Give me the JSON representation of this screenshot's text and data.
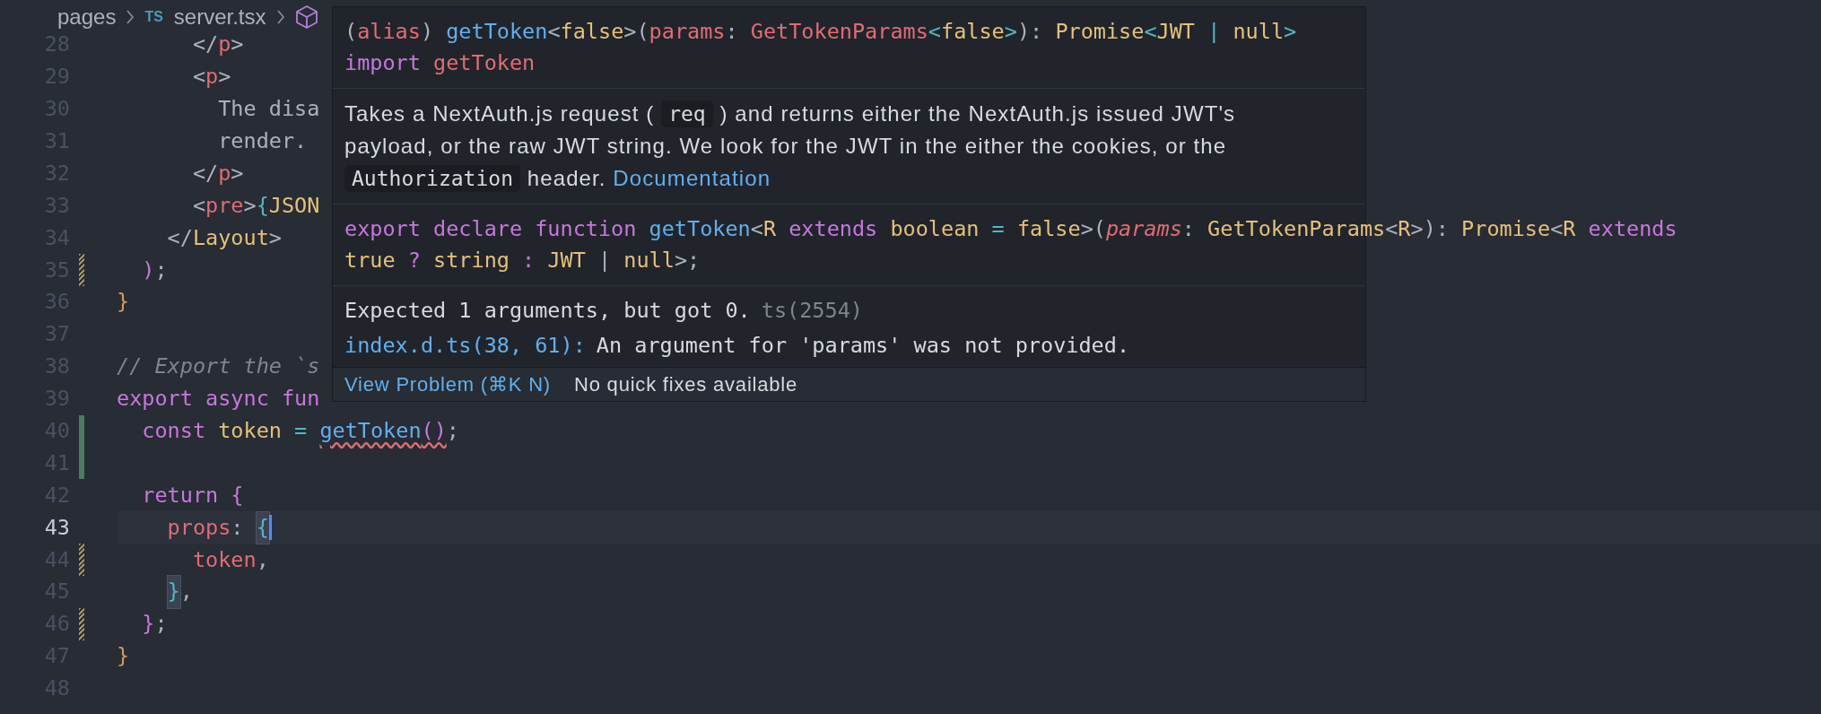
{
  "breadcrumb": [
    {
      "kind": "folder",
      "label": "pages"
    },
    {
      "kind": "file",
      "badge": "TS",
      "label": "server.tsx"
    },
    {
      "kind": "symbol"
    }
  ],
  "lines": [
    {
      "number": "28",
      "added": false,
      "modified": false,
      "current": false,
      "tokens": [
        {
          "text": "      </",
          "kind": "plain"
        },
        {
          "text": "p",
          "kind": "tag"
        },
        {
          "text": ">",
          "kind": "plain"
        }
      ]
    },
    {
      "number": "29",
      "added": false,
      "modified": false,
      "current": false,
      "tokens": [
        {
          "text": "      <",
          "kind": "plain"
        },
        {
          "text": "p",
          "kind": "tag"
        },
        {
          "text": ">",
          "kind": "plain"
        }
      ]
    },
    {
      "number": "30",
      "added": false,
      "modified": false,
      "current": false,
      "tokens": [
        {
          "text": "        The disa",
          "kind": "plain"
        }
      ]
    },
    {
      "number": "31",
      "added": false,
      "modified": false,
      "current": false,
      "tokens": [
        {
          "text": "        render.",
          "kind": "plain"
        }
      ]
    },
    {
      "number": "32",
      "added": false,
      "modified": false,
      "current": false,
      "tokens": [
        {
          "text": "      </",
          "kind": "plain"
        },
        {
          "text": "p",
          "kind": "tag"
        },
        {
          "text": ">",
          "kind": "plain"
        }
      ]
    },
    {
      "number": "33",
      "added": false,
      "modified": false,
      "current": false,
      "tokens": [
        {
          "text": "      <",
          "kind": "plain"
        },
        {
          "text": "pre",
          "kind": "tag"
        },
        {
          "text": ">",
          "kind": "plain"
        },
        {
          "text": "{",
          "kind": "punct"
        },
        {
          "text": "JSON",
          "kind": "type"
        }
      ]
    },
    {
      "number": "34",
      "added": false,
      "modified": false,
      "current": false,
      "tokens": [
        {
          "text": "    </",
          "kind": "plain"
        },
        {
          "text": "Layout",
          "kind": "type"
        },
        {
          "text": ">",
          "kind": "plain"
        }
      ]
    },
    {
      "number": "35",
      "added": false,
      "modified": true,
      "current": false,
      "tokens": [
        {
          "text": "  )",
          "kind": "keyword"
        },
        {
          "text": ";",
          "kind": "plain"
        }
      ]
    },
    {
      "number": "36",
      "added": false,
      "modified": false,
      "current": false,
      "tokens": [
        {
          "text": "}",
          "kind": "orange"
        }
      ]
    },
    {
      "number": "37",
      "added": false,
      "modified": false,
      "current": false
    },
    {
      "number": "38",
      "added": false,
      "modified": false,
      "current": false,
      "tokens": [
        {
          "text": "// Export the `s",
          "kind": "comment"
        }
      ]
    },
    {
      "number": "39",
      "added": false,
      "modified": false,
      "current": false,
      "tokens": [
        {
          "text": "export async fun",
          "kind": "keyword"
        }
      ]
    },
    {
      "number": "40",
      "added": true,
      "modified": false,
      "current": false,
      "tokens": [
        {
          "text": "  const ",
          "kind": "keyword"
        },
        {
          "text": "token ",
          "kind": "type"
        },
        {
          "text": "= ",
          "kind": "punct"
        },
        {
          "text": "getToken",
          "kind": "func",
          "squiggle": true
        },
        {
          "text": "()",
          "kind": "keyword",
          "squiggle": true
        },
        {
          "text": ";",
          "kind": "plain"
        }
      ]
    },
    {
      "number": "41",
      "added": true,
      "modified": false,
      "current": false
    },
    {
      "number": "42",
      "added": false,
      "modified": false,
      "current": false,
      "tokens": [
        {
          "text": "  return ",
          "kind": "keyword"
        },
        {
          "text": "{",
          "kind": "keyword"
        }
      ]
    },
    {
      "number": "43",
      "added": false,
      "modified": false,
      "current": true,
      "tokens": [
        {
          "text": "    props",
          "kind": "tag"
        },
        {
          "text": ": ",
          "kind": "plain"
        },
        {
          "text": "{",
          "kind": "punct",
          "match": true
        }
      ]
    },
    {
      "number": "44",
      "added": false,
      "modified": true,
      "current": false,
      "tokens": [
        {
          "text": "      token",
          "kind": "tag"
        },
        {
          "text": ",",
          "kind": "plain"
        }
      ]
    },
    {
      "number": "45",
      "added": false,
      "modified": false,
      "current": false,
      "tokens": [
        {
          "text": "    }",
          "kind": "punct",
          "match": true
        },
        {
          "text": ",",
          "kind": "plain"
        }
      ]
    },
    {
      "number": "46",
      "added": false,
      "modified": true,
      "current": false,
      "tokens": [
        {
          "text": "  }",
          "kind": "keyword"
        },
        {
          "text": ";",
          "kind": "plain"
        }
      ]
    },
    {
      "number": "47",
      "added": false,
      "modified": false,
      "current": false,
      "tokens": [
        {
          "text": "}",
          "kind": "orange"
        }
      ]
    },
    {
      "number": "48",
      "added": false,
      "modified": false,
      "current": false
    }
  ],
  "hover": {
    "signature": [
      [
        {
          "text": "(",
          "kind": "plain"
        },
        {
          "text": "alias",
          "kind": "tag"
        },
        {
          "text": ") ",
          "kind": "plain"
        },
        {
          "text": "getToken",
          "kind": "func"
        },
        {
          "text": "<",
          "kind": "plain"
        },
        {
          "text": "false",
          "kind": "type"
        },
        {
          "text": ">(",
          "kind": "plain"
        },
        {
          "text": "params",
          "kind": "tag"
        },
        {
          "text": ": ",
          "kind": "plain"
        },
        {
          "text": "GetTokenParams",
          "kind": "tag"
        },
        {
          "text": "<",
          "kind": "punct"
        },
        {
          "text": "false",
          "kind": "type"
        },
        {
          "text": ">",
          "kind": "punct"
        },
        {
          "text": "): ",
          "kind": "plain"
        },
        {
          "text": "Promise",
          "kind": "type"
        },
        {
          "text": "<",
          "kind": "punct"
        },
        {
          "text": "JWT ",
          "kind": "type"
        },
        {
          "text": "| ",
          "kind": "punct"
        },
        {
          "text": "null",
          "kind": "type"
        },
        {
          "text": ">",
          "kind": "punct"
        }
      ],
      [
        {
          "text": "import ",
          "kind": "keyword"
        },
        {
          "text": "getToken",
          "kind": "tag"
        }
      ]
    ],
    "doc": [
      {
        "kind": "text",
        "text": "Takes a NextAuth.js request ("
      },
      {
        "kind": "code",
        "text": "req"
      },
      {
        "kind": "text",
        "text": ") and returns either the NextAuth.js issued JWT's payload, or the raw JWT string. We look for the JWT in the either the cookies, or the"
      },
      {
        "kind": "code",
        "text": "Authorization"
      },
      {
        "kind": "text",
        "text": "header."
      },
      {
        "kind": "link",
        "text": "Documentation"
      }
    ],
    "declaration": [
      [
        {
          "text": "export declare function ",
          "kind": "keyword"
        },
        {
          "text": "getToken",
          "kind": "func"
        },
        {
          "text": "<",
          "kind": "plain"
        },
        {
          "text": "R ",
          "kind": "type"
        },
        {
          "text": "extends ",
          "kind": "keyword"
        },
        {
          "text": "boolean ",
          "kind": "type"
        },
        {
          "text": "= ",
          "kind": "punct"
        },
        {
          "text": "false",
          "kind": "type"
        },
        {
          "text": ">(",
          "kind": "plain"
        },
        {
          "text": "params",
          "kind": "param"
        },
        {
          "text": ": ",
          "kind": "plain"
        },
        {
          "text": "GetTokenParams",
          "kind": "type"
        },
        {
          "text": "<",
          "kind": "plain"
        },
        {
          "text": "R",
          "kind": "type"
        },
        {
          "text": ">): ",
          "kind": "plain"
        },
        {
          "text": "Promise",
          "kind": "type"
        },
        {
          "text": "<",
          "kind": "plain"
        },
        {
          "text": "R ",
          "kind": "type"
        },
        {
          "text": "extends",
          "kind": "keyword"
        }
      ],
      [
        {
          "text": "true ",
          "kind": "type"
        },
        {
          "text": "? ",
          "kind": "keyword"
        },
        {
          "text": "string ",
          "kind": "type"
        },
        {
          "text": ": ",
          "kind": "keyword"
        },
        {
          "text": "JWT ",
          "kind": "type"
        },
        {
          "text": "| ",
          "kind": "plain"
        },
        {
          "text": "null",
          "kind": "type"
        },
        {
          "text": ">;",
          "kind": "plain"
        }
      ]
    ],
    "error": {
      "message": "Expected 1 arguments, but got 0.",
      "code": "ts(2554)"
    },
    "related": {
      "location": "index.d.ts(38, 61):",
      "message": "An argument for 'params' was not provided."
    },
    "footer": {
      "action": "View Problem (⌘K N)",
      "note": "No quick fixes available"
    }
  }
}
